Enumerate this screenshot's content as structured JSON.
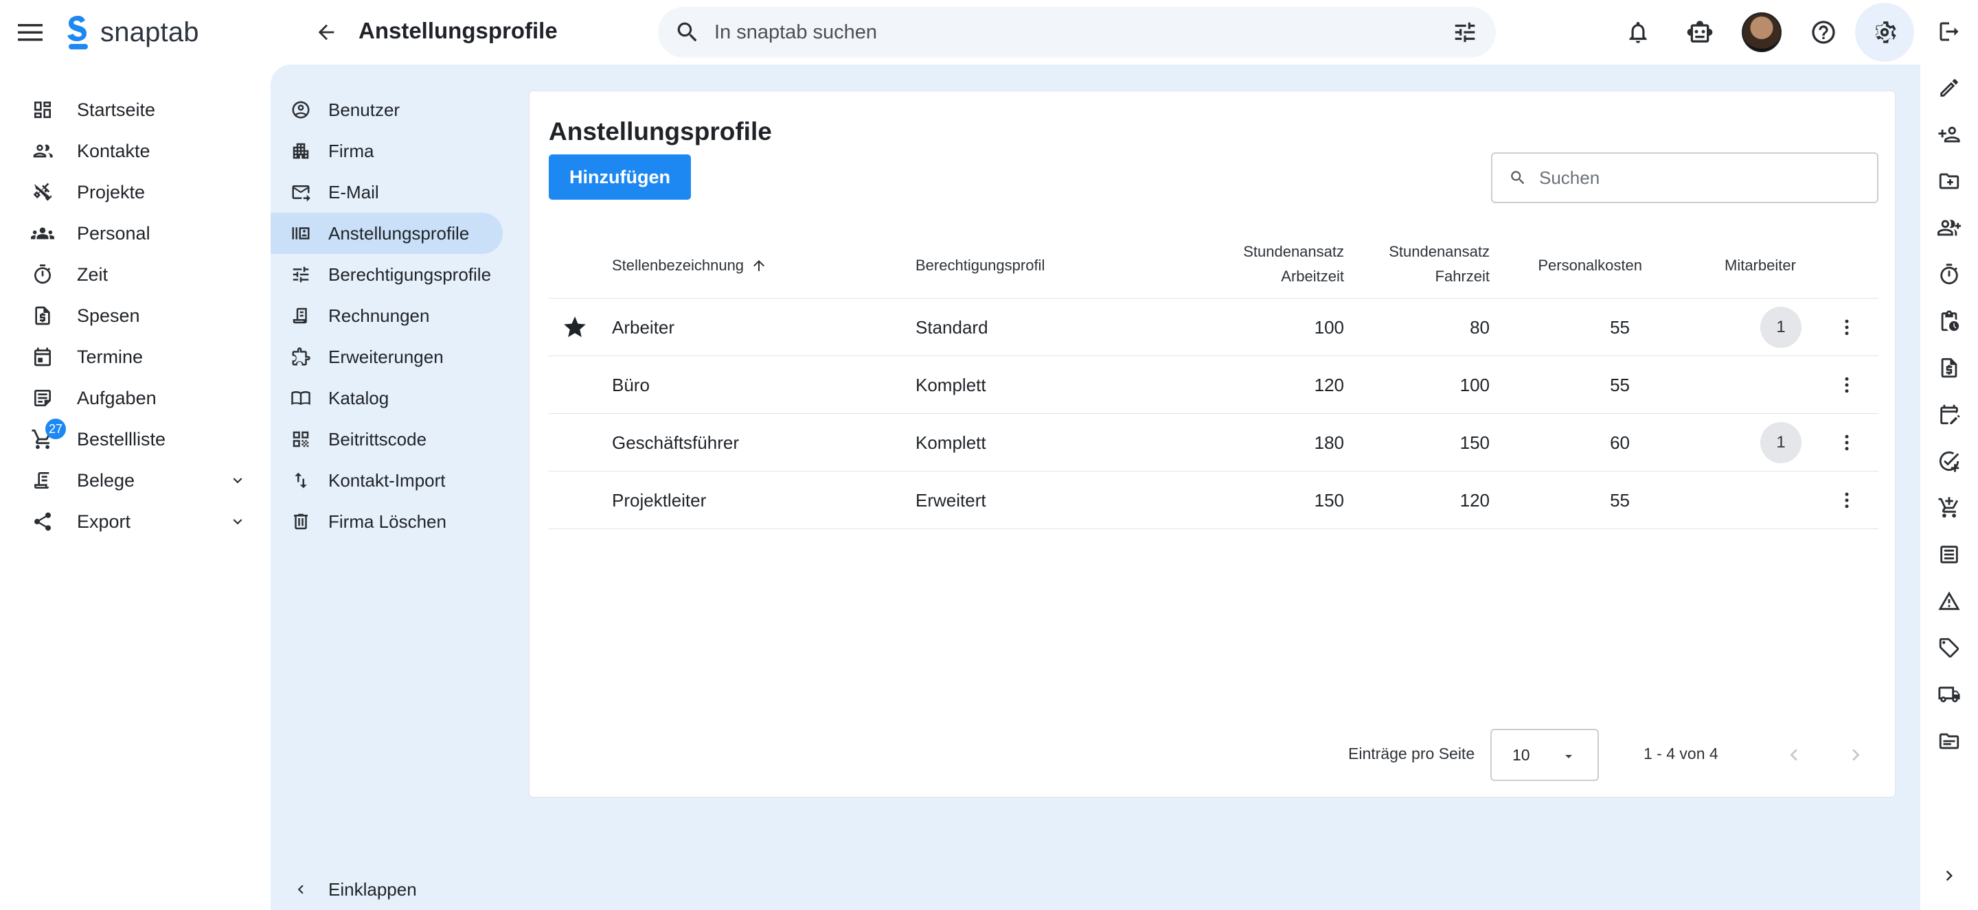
{
  "app": {
    "name": "snaptab"
  },
  "header": {
    "title": "Anstellungsprofile",
    "search_placeholder": "In snaptab suchen"
  },
  "nav": {
    "items": [
      {
        "label": "Startseite",
        "icon": "dashboard-icon"
      },
      {
        "label": "Kontakte",
        "icon": "contacts-icon"
      },
      {
        "label": "Projekte",
        "icon": "tools-icon"
      },
      {
        "label": "Personal",
        "icon": "people-icon"
      },
      {
        "label": "Zeit",
        "icon": "timer-icon"
      },
      {
        "label": "Spesen",
        "icon": "receipt-dollar-icon"
      },
      {
        "label": "Termine",
        "icon": "calendar-icon"
      },
      {
        "label": "Aufgaben",
        "icon": "task-icon"
      },
      {
        "label": "Bestellliste",
        "icon": "cart-icon",
        "badge": "27"
      },
      {
        "label": "Belege",
        "icon": "document-icon"
      },
      {
        "label": "Export",
        "icon": "share-icon"
      }
    ]
  },
  "settings_nav": {
    "items": [
      {
        "label": "Benutzer"
      },
      {
        "label": "Firma"
      },
      {
        "label": "E-Mail"
      },
      {
        "label": "Anstellungsprofile",
        "active": true
      },
      {
        "label": "Berechtigungsprofile"
      },
      {
        "label": "Rechnungen"
      },
      {
        "label": "Erweiterungen"
      },
      {
        "label": "Katalog"
      },
      {
        "label": "Beitrittscode"
      },
      {
        "label": "Kontakt-Import"
      },
      {
        "label": "Firma Löschen"
      }
    ],
    "collapse_label": "Einklappen"
  },
  "card": {
    "title": "Anstellungsprofile",
    "add_label": "Hinzufügen",
    "search_placeholder": "Suchen",
    "columns": {
      "title": "Stellenbezeichnung",
      "permission": "Berechtigungsprofil",
      "rate_work_1": "Stundenansatz",
      "rate_work_2": "Arbeitzeit",
      "rate_travel_1": "Stundenansatz",
      "rate_travel_2": "Fahrzeit",
      "cost": "Personalkosten",
      "employees": "Mitarbeiter"
    },
    "rows": [
      {
        "title": "Arbeiter",
        "permission": "Standard",
        "rate_work": "100",
        "rate_travel": "80",
        "cost": "55",
        "employees": "1",
        "starred": true
      },
      {
        "title": "Büro",
        "permission": "Komplett",
        "rate_work": "120",
        "rate_travel": "100",
        "cost": "55",
        "employees": ""
      },
      {
        "title": "Geschäftsführer",
        "permission": "Komplett",
        "rate_work": "180",
        "rate_travel": "150",
        "cost": "60",
        "employees": "1"
      },
      {
        "title": "Projektleiter",
        "permission": "Erweitert",
        "rate_work": "150",
        "rate_travel": "120",
        "cost": "55",
        "employees": ""
      }
    ],
    "pagination": {
      "per_page_label": "Einträge pro Seite",
      "per_page_value": "10",
      "range": "1 - 4 von 4"
    }
  },
  "colors": {
    "accent": "#1e88f2",
    "content_bg": "#e6f0fb",
    "active_item": "#c9e0f8"
  }
}
